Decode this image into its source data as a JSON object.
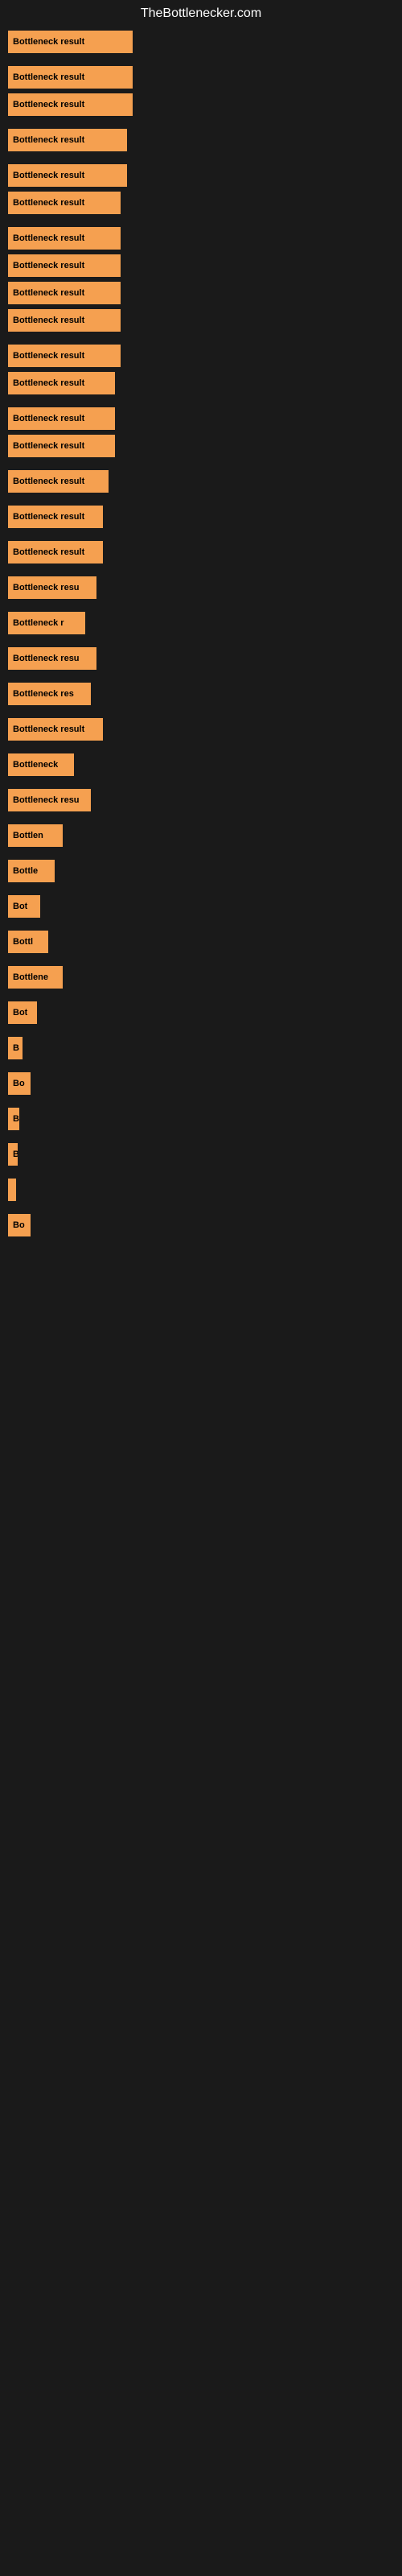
{
  "site": {
    "title": "TheBottlenecker.com"
  },
  "bars": [
    {
      "label": "Bottleneck result",
      "width": 155
    },
    {
      "label": "Bottleneck result",
      "width": 155
    },
    {
      "label": "Bottleneck result",
      "width": 155
    },
    {
      "label": "Bottleneck result",
      "width": 148
    },
    {
      "label": "Bottleneck result",
      "width": 148
    },
    {
      "label": "Bottleneck result",
      "width": 140
    },
    {
      "label": "Bottleneck result",
      "width": 140
    },
    {
      "label": "Bottleneck result",
      "width": 140
    },
    {
      "label": "Bottleneck result",
      "width": 140
    },
    {
      "label": "Bottleneck result",
      "width": 140
    },
    {
      "label": "Bottleneck result",
      "width": 140
    },
    {
      "label": "Bottleneck result",
      "width": 133
    },
    {
      "label": "Bottleneck result",
      "width": 133
    },
    {
      "label": "Bottleneck result",
      "width": 133
    },
    {
      "label": "Bottleneck result",
      "width": 125
    },
    {
      "label": "Bottleneck result",
      "width": 118
    },
    {
      "label": "Bottleneck result",
      "width": 118
    },
    {
      "label": "Bottleneck resu",
      "width": 110
    },
    {
      "label": "Bottleneck r",
      "width": 96
    },
    {
      "label": "Bottleneck resu",
      "width": 110
    },
    {
      "label": "Bottleneck res",
      "width": 103
    },
    {
      "label": "Bottleneck result",
      "width": 118
    },
    {
      "label": "Bottleneck",
      "width": 82
    },
    {
      "label": "Bottleneck resu",
      "width": 103
    },
    {
      "label": "Bottlen",
      "width": 68
    },
    {
      "label": "Bottle",
      "width": 58
    },
    {
      "label": "Bot",
      "width": 40
    },
    {
      "label": "Bottl",
      "width": 50
    },
    {
      "label": "Bottlene",
      "width": 68
    },
    {
      "label": "Bot",
      "width": 36
    },
    {
      "label": "B",
      "width": 18
    },
    {
      "label": "Bo",
      "width": 28
    },
    {
      "label": "B",
      "width": 14
    },
    {
      "label": "B",
      "width": 12
    },
    {
      "label": "",
      "width": 8
    },
    {
      "label": "Bo",
      "width": 28
    }
  ]
}
